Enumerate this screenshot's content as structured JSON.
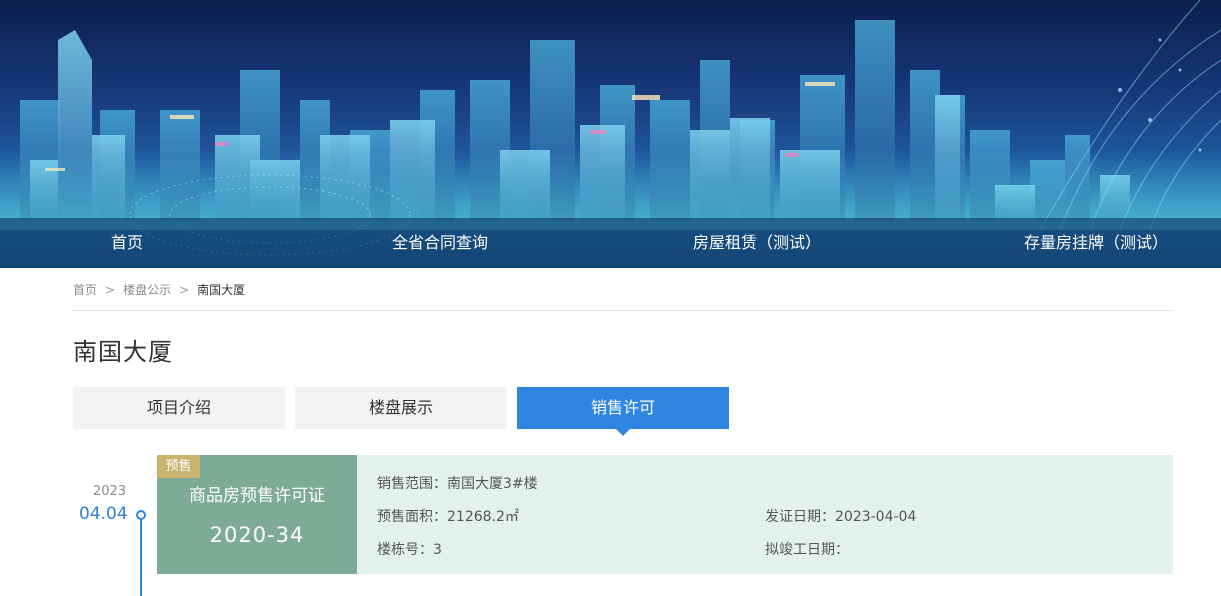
{
  "nav": {
    "items": [
      "首页",
      "全省合同查询",
      "房屋租赁（测试）",
      "存量房挂牌（测试）"
    ]
  },
  "breadcrumb": {
    "items": [
      "首页",
      "楼盘公示"
    ],
    "separator": ">",
    "current": "南国大厦"
  },
  "project": {
    "title": "南国大厦"
  },
  "tabs": {
    "items": [
      "项目介绍",
      "楼盘展示",
      "销售许可"
    ],
    "active_index": 2
  },
  "timeline": {
    "year": "2023",
    "date": "04.04"
  },
  "permit": {
    "badge": "预售",
    "name": "商品房预售许可证",
    "number": "2020-34",
    "sales_scope_label": "销售范围：",
    "sales_scope_value": "南国大厦3#楼",
    "presale_area_label": "预售面积：",
    "presale_area_value": "21268.2㎡",
    "building_no_label": "楼栋号：",
    "building_no_value": "3",
    "issue_date_label": "发证日期：",
    "issue_date_value": "2023-04-04",
    "completion_date_label": "拟竣工日期：",
    "completion_date_value": ""
  },
  "colors": {
    "accent": "#2f86e0",
    "permit_green": "#7eab96",
    "permit_bg": "#e2f1ec",
    "badge_gold": "#c9b36e"
  }
}
